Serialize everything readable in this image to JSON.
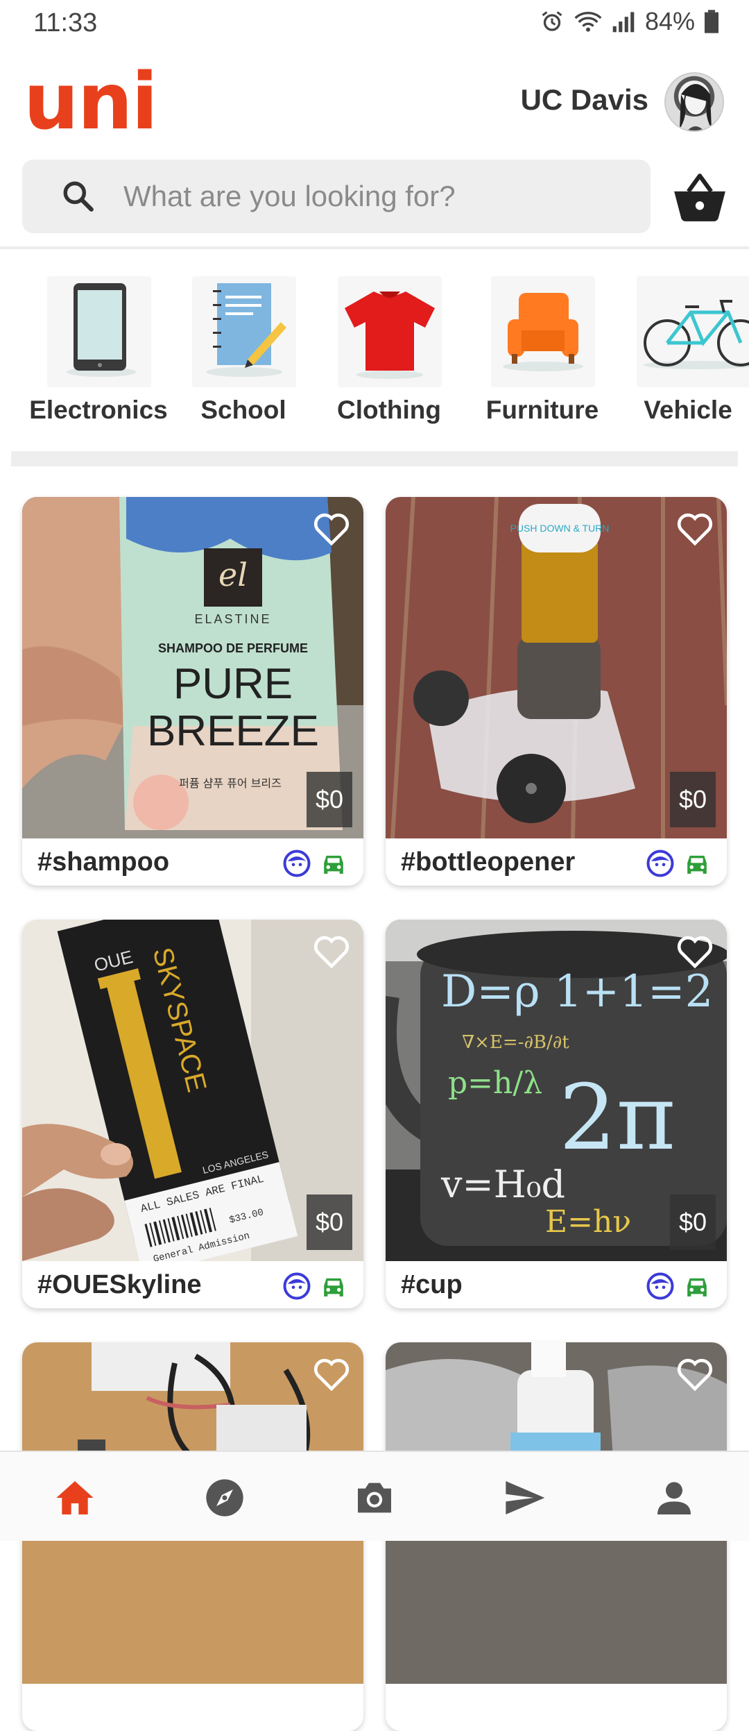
{
  "status_bar": {
    "time": "11:33",
    "battery": "84%"
  },
  "header": {
    "logo": "uni",
    "campus": "UC Davis"
  },
  "search": {
    "placeholder": "What are you looking for?"
  },
  "categories": [
    {
      "label": "Electronics",
      "icon": "tablet-icon"
    },
    {
      "label": "School",
      "icon": "notebook-icon"
    },
    {
      "label": "Clothing",
      "icon": "tshirt-icon"
    },
    {
      "label": "Furniture",
      "icon": "armchair-icon"
    },
    {
      "label": "Vehicle",
      "icon": "bicycle-icon"
    }
  ],
  "listings": [
    {
      "tag": "#shampoo",
      "price": "$0",
      "photo_text": {
        "brand": "ELASTINE",
        "line1": "SHAMPOO DE PERFUME",
        "line2": "PURE",
        "line3": "BREEZE",
        "line4": "퍼퓸 샴푸 퓨어 브리즈"
      }
    },
    {
      "tag": "#bottleopener",
      "price": "$0",
      "photo_text": {
        "cap": "PUSH DOWN & TURN"
      }
    },
    {
      "tag": "#OUESkyline",
      "price": "$0",
      "photo_text": {
        "brand": "OUE",
        "title": "SKYSPACE",
        "sub": "LOS ANGELES",
        "fine": "ALL SALES ARE FINAL",
        "amount": "$33.00",
        "admission": "General Admission"
      }
    },
    {
      "tag": "#cup",
      "price": "$0",
      "photo_text": {
        "eq1": "D=ρ 1+1=2",
        "eq2": "∇×E=-∂B/∂t",
        "eq3": "p=h/λ",
        "eq4": "2π",
        "eq5": "v=H₀d",
        "eq6": "E=hν"
      }
    },
    {
      "tag": "",
      "price": ""
    },
    {
      "tag": "",
      "price": ""
    }
  ],
  "colors": {
    "brand": "#e8401c",
    "face_badge": "#3b3bd8",
    "car_badge": "#2e9e3a"
  },
  "bottom_nav": [
    {
      "icon": "home-icon"
    },
    {
      "icon": "compass-icon"
    },
    {
      "icon": "camera-icon"
    },
    {
      "icon": "send-icon"
    },
    {
      "icon": "profile-icon"
    }
  ]
}
